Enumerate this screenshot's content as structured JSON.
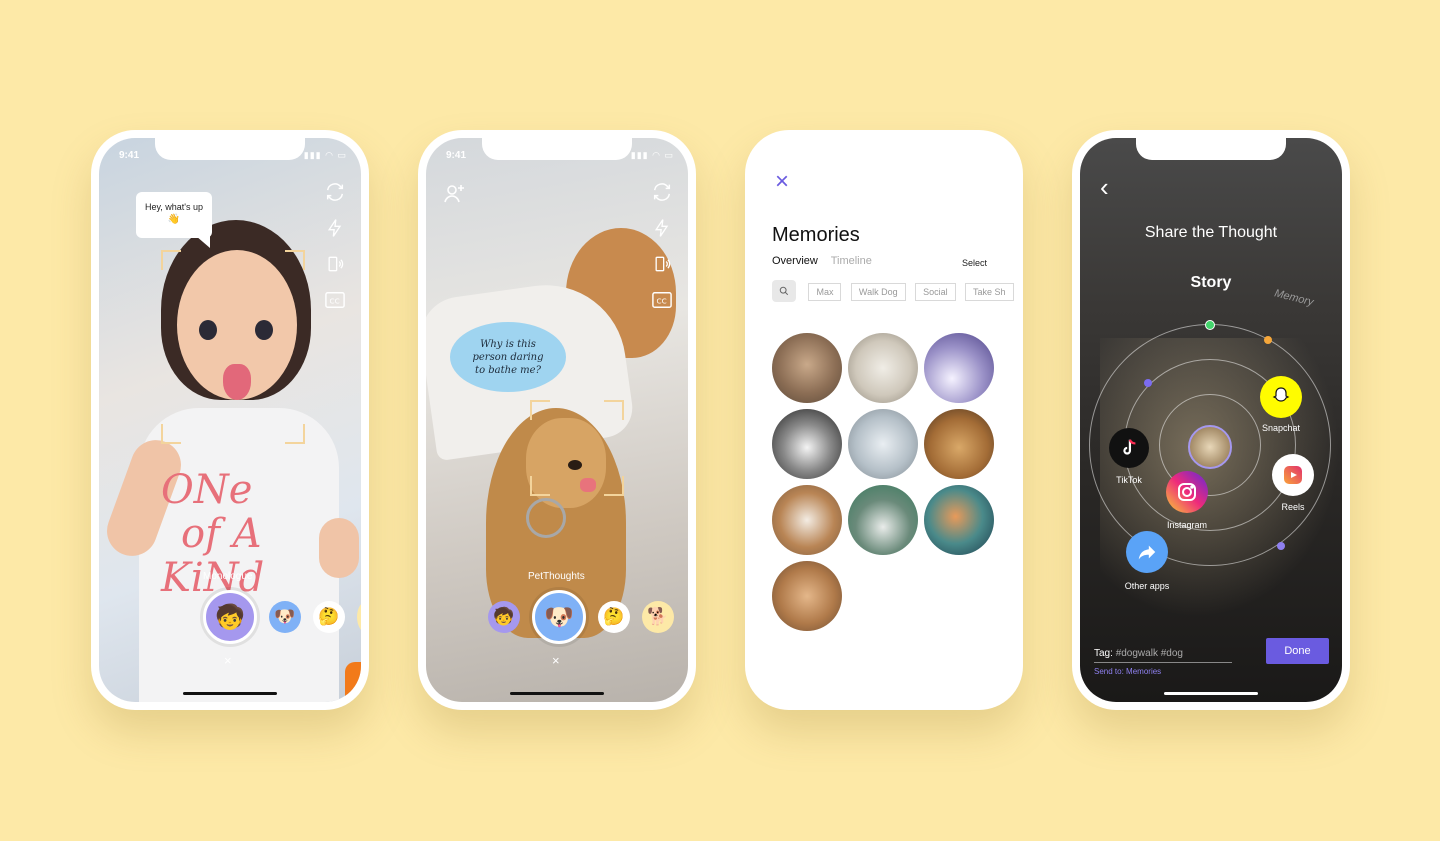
{
  "status": {
    "time": "9:41",
    "icons": "▮▮▮ ◠ ▭"
  },
  "screen1": {
    "bubble_text": "Hey, what's up",
    "bubble_emoji": "👋",
    "mode_label": "Monologue",
    "close_glyph": "×",
    "shirt_text": [
      "ONe",
      "of A",
      "KiNd"
    ],
    "lenses": [
      "🧒",
      "🐶",
      "🤔"
    ]
  },
  "screen2": {
    "bubble_text": "Why is this person daring to bathe me?",
    "mode_label": "PetThoughts",
    "close_glyph": "×",
    "lenses": [
      "🧒",
      "🐶",
      "🤔",
      "🐕"
    ]
  },
  "screen3": {
    "close_glyph": "×",
    "title": "Memories",
    "tabs": [
      "Overview",
      "Timeline"
    ],
    "select_label": "Select",
    "tags": [
      "Max",
      "Walk Dog",
      "Social",
      "Take Sh"
    ],
    "photo_count": 10
  },
  "screen4": {
    "back_glyph": "‹",
    "title": "Share the Thought",
    "story_label": "Story",
    "memory_label": "Memory",
    "apps": {
      "snapchat": "Snapchat",
      "tiktok": "TikTok",
      "instagram": "Instagram",
      "reels": "Reels",
      "other": "Other apps"
    },
    "tag_label": "Tag:",
    "tag_value": "#dogwalk #dog",
    "send_to_label": "Send to:",
    "send_to_value": "Memories",
    "done_label": "Done"
  },
  "colors": {
    "background": "#fde9a7",
    "accent": "#6a5be0",
    "frame_corner": "#f3d49c"
  }
}
